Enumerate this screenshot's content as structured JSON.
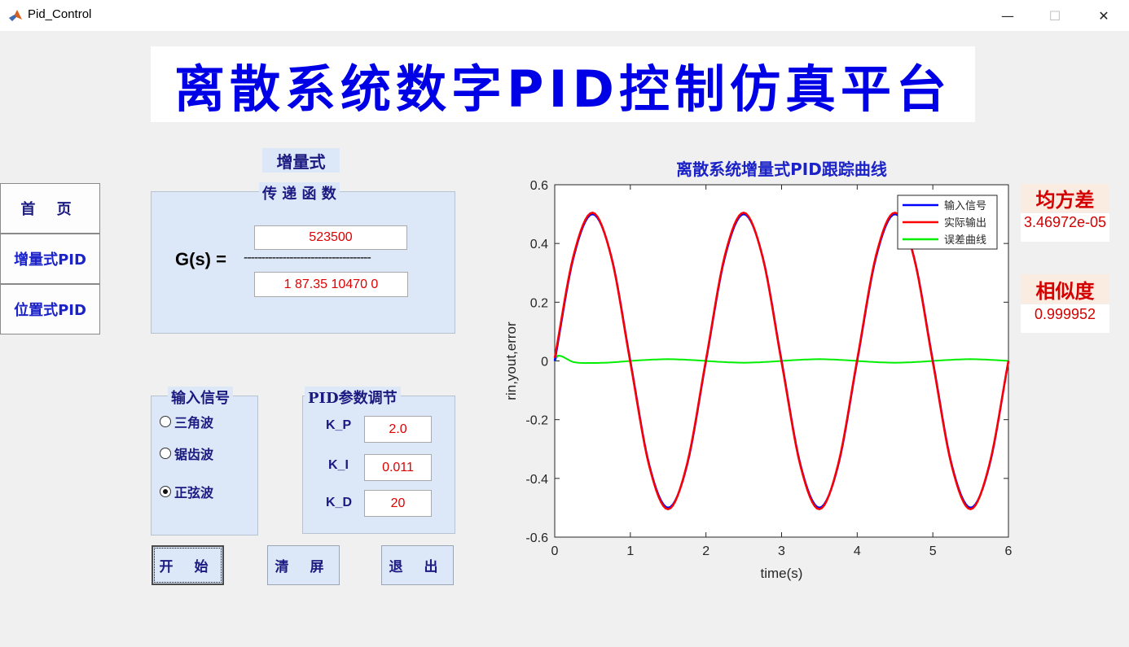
{
  "window": {
    "title": "Pid_Control",
    "minimize": "—",
    "maximize": "☐",
    "close": "✕"
  },
  "banner": {
    "title": "离散系统数字PID控制仿真平台"
  },
  "mode_label": "增量式",
  "nav": {
    "home": "首 页",
    "incremental": "增量式PID",
    "positional": "位置式PID"
  },
  "transfer": {
    "title": "传 递 函 数",
    "label": "G(s) =",
    "numerator": "523500",
    "denominator": "1 87.35 10470 0",
    "fraction_line": "------------------------------------"
  },
  "input_signal": {
    "title": "输入信号",
    "options": [
      {
        "label": "三角波",
        "selected": false
      },
      {
        "label": "锯齿波",
        "selected": false
      },
      {
        "label": "正弦波",
        "selected": true
      }
    ]
  },
  "pid": {
    "title": "PID参数调节",
    "params": [
      {
        "label": "K_P",
        "value": "2.0"
      },
      {
        "label": "K_I",
        "value": "0.011"
      },
      {
        "label": "K_D",
        "value": "20"
      }
    ]
  },
  "actions": {
    "start": "开 始",
    "clear": "清 屏",
    "exit": "退 出"
  },
  "metrics": {
    "mse_label": "均方差",
    "mse_value": "3.46972e-05",
    "similarity_label": "相似度",
    "similarity_value": "0.999952"
  },
  "chart_data": {
    "type": "line",
    "title": "离散系统增量式PID跟踪曲线",
    "xlabel": "time(s)",
    "ylabel": "rin,yout,error",
    "xlim": [
      0,
      6
    ],
    "ylim": [
      -0.6,
      0.6
    ],
    "xticks": [
      "0",
      "1",
      "2",
      "3",
      "4",
      "5",
      "6"
    ],
    "yticks": [
      "0.6",
      "0.4",
      "0.2",
      "0",
      "-0.2",
      "-0.4",
      "-0.6"
    ],
    "grid": false,
    "legend_position": "top-right",
    "series": [
      {
        "name": "输入信号",
        "color": "#0000ff",
        "x": [
          0,
          0.25,
          0.5,
          0.75,
          1,
          1.25,
          1.5,
          1.75,
          2,
          2.25,
          2.5,
          2.75,
          3,
          3.25,
          3.5,
          3.75,
          4,
          4.25,
          4.5,
          4.75,
          5,
          5.25,
          5.5,
          5.75,
          6
        ],
        "y": [
          0,
          0.354,
          0.5,
          0.354,
          0,
          -0.354,
          -0.5,
          -0.354,
          0,
          0.354,
          0.5,
          0.354,
          0,
          -0.354,
          -0.5,
          -0.354,
          0,
          0.354,
          0.5,
          0.354,
          0,
          -0.354,
          -0.5,
          -0.354,
          0
        ]
      },
      {
        "name": "实际输出",
        "color": "#ff0000",
        "x": [
          0,
          0.25,
          0.5,
          0.75,
          1,
          1.25,
          1.5,
          1.75,
          2,
          2.25,
          2.5,
          2.75,
          3,
          3.25,
          3.5,
          3.75,
          4,
          4.25,
          4.5,
          4.75,
          5,
          5.25,
          5.5,
          5.75,
          6
        ],
        "y": [
          0.01,
          0.36,
          0.505,
          0.352,
          -0.005,
          -0.358,
          -0.505,
          -0.35,
          0.005,
          0.36,
          0.505,
          0.352,
          -0.005,
          -0.358,
          -0.505,
          -0.35,
          0.005,
          0.36,
          0.505,
          0.352,
          -0.005,
          -0.358,
          -0.505,
          -0.35,
          0
        ]
      },
      {
        "name": "误差曲线",
        "color": "#00ee00",
        "x": [
          0,
          0.05,
          0.25,
          0.5,
          0.75,
          1,
          1.25,
          1.5,
          1.75,
          2,
          2.25,
          2.5,
          2.75,
          3,
          3.25,
          3.5,
          3.75,
          4,
          4.25,
          4.5,
          4.75,
          5,
          5.25,
          5.5,
          5.75,
          6
        ],
        "y": [
          0,
          0.018,
          -0.004,
          -0.007,
          -0.005,
          0,
          0.004,
          0.006,
          0.004,
          0,
          -0.004,
          -0.006,
          -0.004,
          0,
          0.004,
          0.006,
          0.004,
          0,
          -0.004,
          -0.006,
          -0.004,
          0,
          0.004,
          0.006,
          0.004,
          0
        ]
      }
    ]
  }
}
